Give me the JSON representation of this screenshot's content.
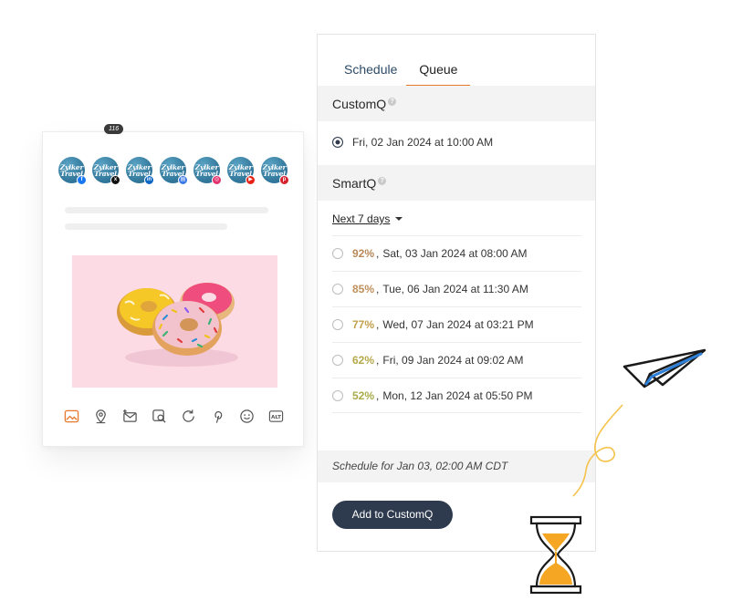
{
  "compose": {
    "profiles": [
      {
        "brand": "Zylker Travel",
        "network": "facebook",
        "color": "#1877f2",
        "glyph": "f"
      },
      {
        "brand": "Zylker Travel",
        "network": "x",
        "color": "#111111",
        "glyph": "x"
      },
      {
        "brand": "Zylker Travel",
        "network": "linkedin",
        "color": "#0a66c2",
        "glyph": "in"
      },
      {
        "brand": "Zylker Travel",
        "network": "google-business",
        "color": "#3b78e7",
        "glyph": "▤"
      },
      {
        "brand": "Zylker Travel",
        "network": "instagram",
        "color": "#e1306c",
        "glyph": "◎"
      },
      {
        "brand": "Zylker Travel",
        "network": "youtube",
        "color": "#e62117",
        "glyph": "▶"
      },
      {
        "brand": "Zylker Travel",
        "network": "pinterest",
        "color": "#d6202b",
        "glyph": "p"
      }
    ],
    "x_char_count": "116",
    "image_subject": "donuts",
    "toolbar_icons": [
      "image-icon",
      "location-pin-icon",
      "add-mail-icon",
      "search-image-icon",
      "refresh-icon",
      "pinterest-icon",
      "emoji-icon",
      "alt-text-icon"
    ],
    "alt_label": "ALT"
  },
  "panel": {
    "tabs": {
      "schedule": "Schedule",
      "queue": "Queue"
    },
    "customq": {
      "title": "CustomQ",
      "selected_slot": "Fri, 02 Jan 2024 at 10:00 AM"
    },
    "smartq": {
      "title": "SmartQ",
      "filter": "Next 7 days",
      "slots": [
        {
          "pct": "92%",
          "sep": ",",
          "time": "Sat, 03 Jan 2024 at 08:00 AM",
          "color": "#b8895a"
        },
        {
          "pct": "85%",
          "sep": ",",
          "time": "Tue, 06 Jan 2024 at 11:30 AM",
          "color": "#c0905c"
        },
        {
          "pct": "77%",
          "sep": ",",
          "time": "Wed, 07 Jan 2024 at 03:21 PM",
          "color": "#c2a04c"
        },
        {
          "pct": "62%",
          "sep": ",",
          "time": "Fri, 09 Jan 2024 at 09:02 AM",
          "color": "#b5a84a"
        },
        {
          "pct": "52%",
          "sep": ",",
          "time": "Mon, 12 Jan 2024 at 05:50 PM",
          "color": "#a9ab49"
        }
      ]
    },
    "schedule_note": "Schedule for Jan 03, 02:00 AM CDT",
    "add_button": "Add to CustomQ"
  },
  "colors": {
    "accent_tab": "#e8792f",
    "button_bg": "#2e3b4e",
    "hourglass_sand": "#f5a623",
    "image_bg": "#fcdbe5"
  }
}
